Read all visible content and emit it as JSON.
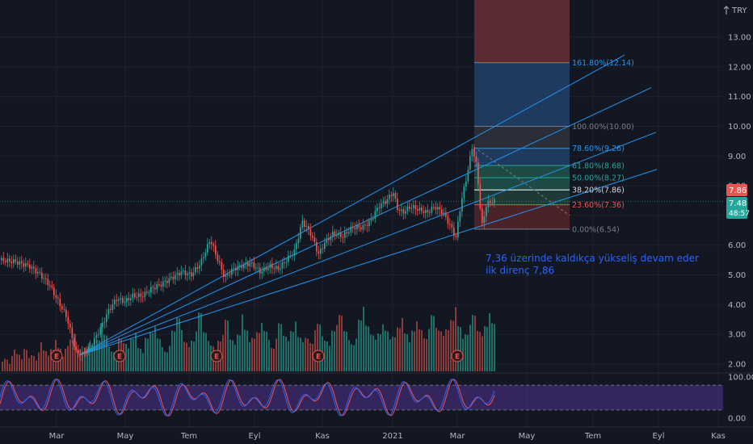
{
  "currency": "TRY",
  "colors": {
    "background": "#131722",
    "grid": "#1e2230",
    "up": "#26a69a",
    "down": "#ef5350",
    "upVol": "#1f6f69",
    "downVol": "#8b3a3a",
    "channel": "#2196f3",
    "note": "#2962ff",
    "stochK": "#2962ff",
    "stochD": "#ef5350",
    "stochBand": "#3d2a6b"
  },
  "chart_data": [
    {
      "type": "candlestick",
      "title": "",
      "y_axis": {
        "min": 1.8,
        "max": 14.0,
        "ticks": [
          "2.00",
          "3.00",
          "4.00",
          "5.00",
          "6.00",
          "7.00",
          "8.00",
          "9.00",
          "10.00",
          "11.00",
          "12.00",
          "13.00"
        ]
      },
      "x_axis": {
        "ticks": [
          "Mar",
          "May",
          "Tem",
          "Eyl",
          "Kas",
          "2021",
          "Mar",
          "May",
          "Tem",
          "Eyl",
          "Kas"
        ]
      },
      "last_price_tags": {
        "upper": "7.86",
        "current": "7.48",
        "countdown": "48:57"
      },
      "price_path": [
        [
          0,
          5.5
        ],
        [
          20,
          5.45
        ],
        [
          38,
          5.3
        ],
        [
          52,
          5.0
        ],
        [
          62,
          4.7
        ],
        [
          72,
          4.2
        ],
        [
          84,
          3.6
        ],
        [
          96,
          2.4
        ],
        [
          104,
          2.35
        ],
        [
          114,
          2.6
        ],
        [
          126,
          3.2
        ],
        [
          136,
          3.8
        ],
        [
          146,
          4.2
        ],
        [
          156,
          4.1
        ],
        [
          166,
          4.3
        ],
        [
          178,
          4.3
        ],
        [
          190,
          4.55
        ],
        [
          202,
          4.7
        ],
        [
          214,
          4.9
        ],
        [
          226,
          5.1
        ],
        [
          238,
          5.0
        ],
        [
          250,
          5.4
        ],
        [
          262,
          6.2
        ],
        [
          270,
          5.6
        ],
        [
          280,
          4.9
        ],
        [
          290,
          5.2
        ],
        [
          300,
          5.3
        ],
        [
          312,
          5.4
        ],
        [
          324,
          5.1
        ],
        [
          336,
          5.3
        ],
        [
          346,
          5.2
        ],
        [
          356,
          5.5
        ],
        [
          366,
          5.8
        ],
        [
          376,
          6.8
        ],
        [
          386,
          6.4
        ],
        [
          396,
          5.7
        ],
        [
          404,
          6.1
        ],
        [
          414,
          6.4
        ],
        [
          426,
          6.3
        ],
        [
          438,
          6.6
        ],
        [
          450,
          6.6
        ],
        [
          460,
          6.8
        ],
        [
          470,
          7.3
        ],
        [
          480,
          7.5
        ],
        [
          488,
          7.8
        ],
        [
          494,
          7.2
        ],
        [
          500,
          7.1
        ],
        [
          510,
          7.3
        ],
        [
          520,
          7.2
        ],
        [
          530,
          7.1
        ],
        [
          540,
          7.3
        ],
        [
          550,
          7.1
        ],
        [
          560,
          6.6
        ],
        [
          566,
          6.25
        ],
        [
          572,
          7.4
        ],
        [
          580,
          8.4
        ],
        [
          586,
          9.3
        ],
        [
          592,
          8.6
        ],
        [
          598,
          6.6
        ],
        [
          604,
          7.4
        ],
        [
          612,
          7.48
        ]
      ],
      "volume_profile": [
        2,
        3,
        2,
        4,
        3,
        2,
        5,
        3,
        4,
        3,
        6,
        4,
        3,
        5,
        8,
        6,
        4,
        5,
        7,
        9,
        5,
        4,
        6,
        8,
        5,
        7,
        12,
        9,
        6,
        5,
        4,
        7,
        6,
        5,
        8,
        10,
        6,
        5,
        7,
        9,
        11,
        8,
        6,
        5,
        7,
        9,
        13,
        10,
        7,
        6,
        8,
        11,
        14,
        9,
        7,
        6,
        5,
        8,
        10,
        12,
        7,
        6,
        9,
        15,
        11,
        8,
        7,
        9,
        12,
        10,
        8,
        6,
        9,
        11,
        8,
        7,
        10,
        13,
        9,
        8,
        7,
        6,
        10,
        12,
        9,
        8,
        7,
        9,
        11,
        14,
        10,
        8,
        7,
        9,
        12,
        16,
        11,
        9,
        8,
        10,
        13,
        9,
        7,
        8,
        11,
        14,
        10,
        8,
        9,
        12,
        10,
        8,
        11,
        15,
        12,
        9,
        8,
        10,
        13,
        17,
        12,
        9,
        8,
        11,
        14,
        10,
        9,
        12,
        16,
        11
      ],
      "fibonacci": {
        "levels": [
          {
            "label": "161.80%(12.14)",
            "price": 12.14,
            "color": "#2196f3"
          },
          {
            "label": "100.00%(10.00)",
            "price": 10.0,
            "color": "#787b86"
          },
          {
            "label": "78.60%(9.26)",
            "price": 9.26,
            "color": "#2196f3"
          },
          {
            "label": "61.80%(8.68)",
            "price": 8.68,
            "color": "#26a69a"
          },
          {
            "label": "50.00%(8.27)",
            "price": 8.27,
            "color": "#26a69a"
          },
          {
            "label": "38.20%(7.86)",
            "price": 7.86,
            "color": "#ffffff"
          },
          {
            "label": "23.60%(7.36)",
            "price": 7.36,
            "color": "#ef5350"
          },
          {
            "label": "0.00%(6.54)",
            "price": 6.54,
            "color": "#787b86"
          }
        ]
      },
      "earnings_markers": [
        "E",
        "E",
        "E",
        "E",
        "E"
      ],
      "annotation": [
        "7,36 üzerinde kaldıkça yükseliş devam eder",
        "ilk direnç 7,86"
      ]
    },
    {
      "type": "line",
      "name": "stochastic",
      "y_axis": {
        "min": 0,
        "max": 100,
        "ticks": [
          "100.00",
          "0.00"
        ]
      },
      "band": [
        20,
        80
      ]
    }
  ]
}
